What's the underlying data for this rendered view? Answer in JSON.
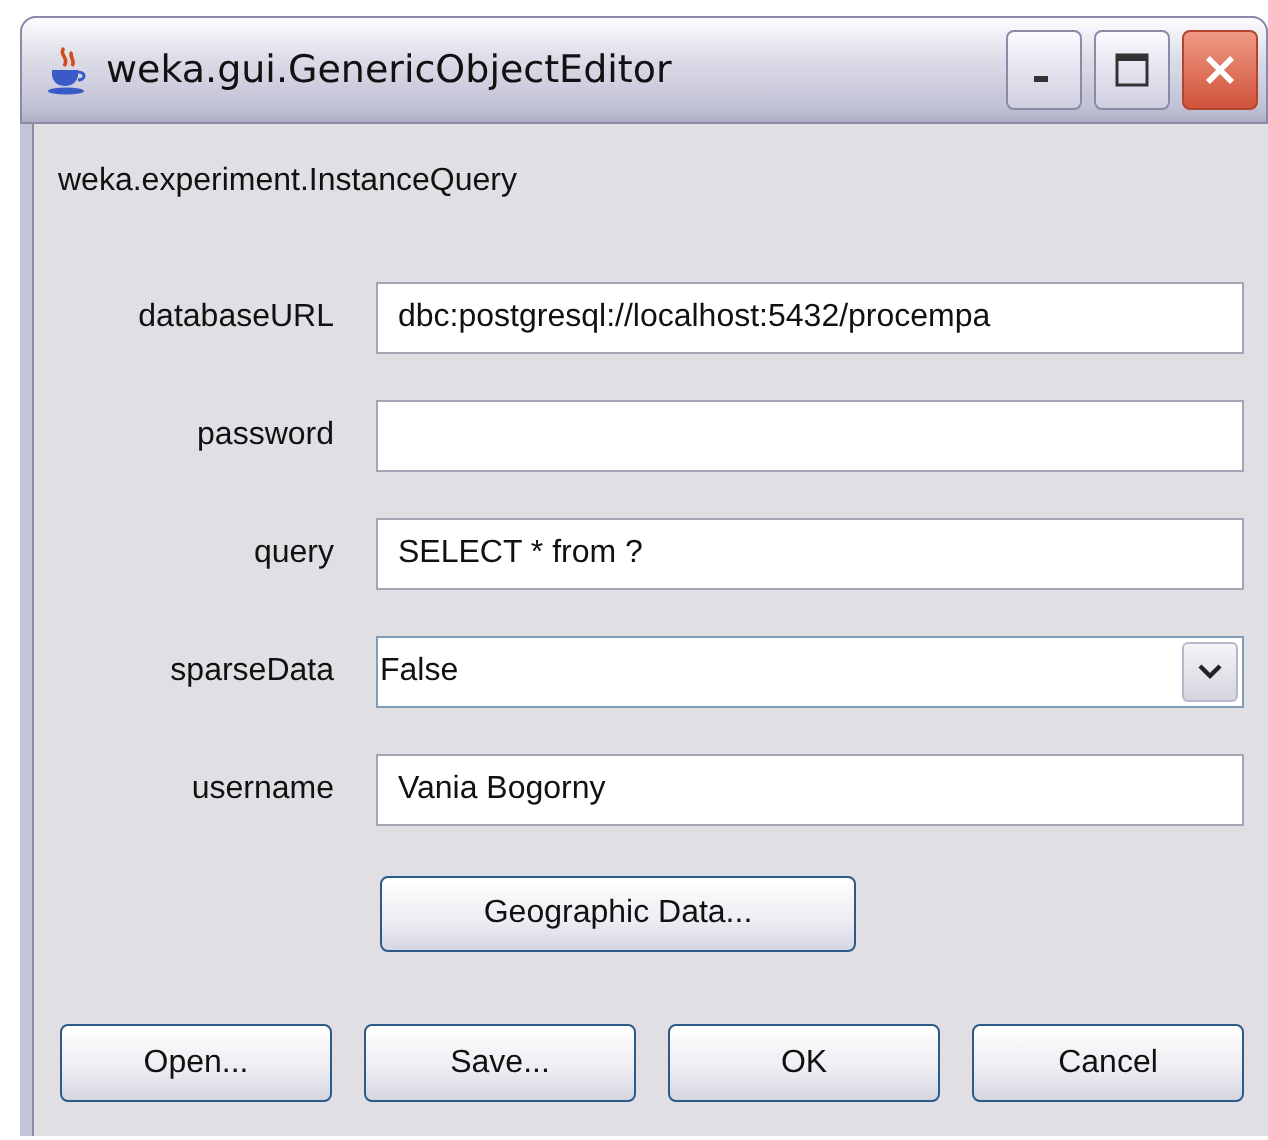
{
  "window": {
    "title": "weka.gui.GenericObjectEditor"
  },
  "class_name": "weka.experiment.InstanceQuery",
  "properties": [
    {
      "label": "databaseURL",
      "kind": "text",
      "value": "dbc:postgresql://localhost:5432/procempa"
    },
    {
      "label": "password",
      "kind": "text"
    },
    {
      "label": "query",
      "kind": "text",
      "value": "SELECT * from ?"
    },
    {
      "label": "sparseData",
      "kind": "dropdown",
      "value": "False"
    },
    {
      "label": "username",
      "kind": "text",
      "value": "Vania Bogorny"
    }
  ],
  "extra_button": "Geographic Data...",
  "buttons": [
    "Open...",
    "Save...",
    "OK",
    "Cancel"
  ]
}
